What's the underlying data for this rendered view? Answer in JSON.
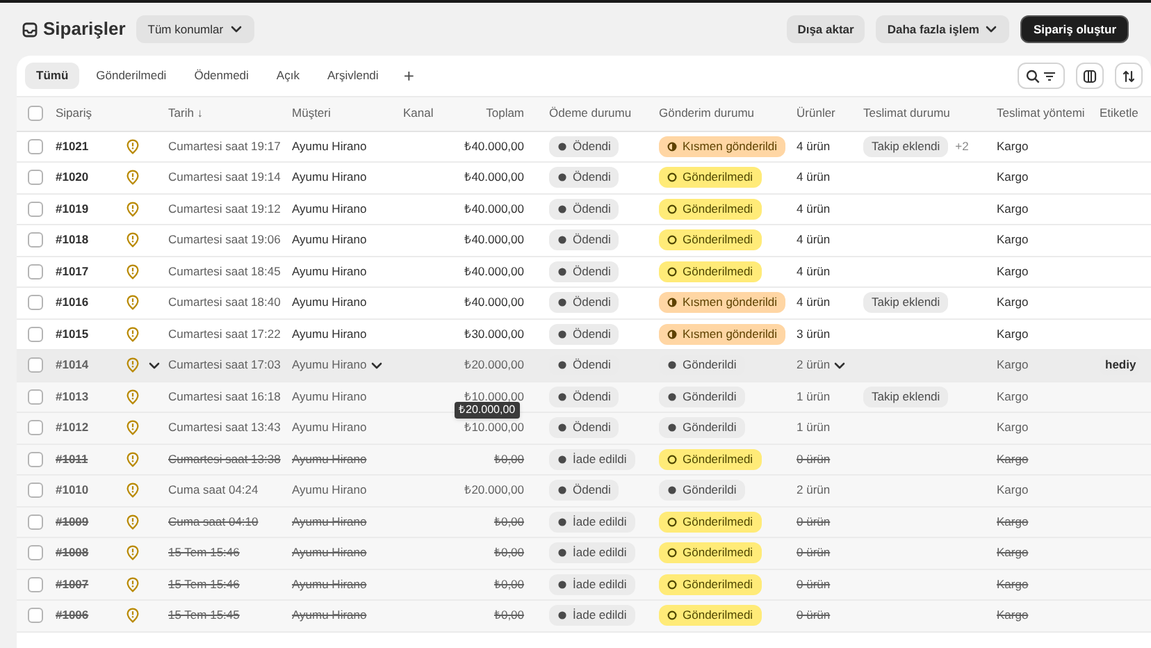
{
  "header": {
    "title": "Siparişler",
    "location_filter": "Tüm konumlar",
    "actions": [
      {
        "label": "Dışa aktar",
        "kind": "plain"
      },
      {
        "label": "Daha fazla işlem",
        "kind": "menu"
      },
      {
        "label": "Sipariş oluştur",
        "kind": "primary"
      }
    ]
  },
  "tabs": [
    {
      "label": "Tümü",
      "selected": true
    },
    {
      "label": "Gönderilmedi",
      "selected": false
    },
    {
      "label": "Ödenmedi",
      "selected": false
    },
    {
      "label": "Açık",
      "selected": false
    },
    {
      "label": "Arşivlendi",
      "selected": false
    }
  ],
  "add_tab": "+",
  "table": {
    "columns": [
      "Sipariş",
      "Tarih ↓",
      "Müşteri",
      "Kanal",
      "Toplam",
      "Ödeme durumu",
      "Gönderim durumu",
      "Ürünler",
      "Teslimat durumu",
      "Teslimat yöntemi",
      "Etiketle"
    ],
    "all_checked": false,
    "rows": [
      {
        "checked": false,
        "order": "#1021",
        "date": "Cumartesi saat 19:17",
        "customer": "Ayumu Hirano",
        "total": "₺40.000,00",
        "payment": "Ödendi",
        "fulfillment": {
          "label": "Kısmen gönderildi",
          "kind": "partial"
        },
        "items": "4 ürün",
        "tracking": "Takip eklendi",
        "tracking_extra": "+2",
        "delivery": "Kargo",
        "archived": false,
        "cancelled": false,
        "hovered": false
      },
      {
        "checked": false,
        "order": "#1020",
        "date": "Cumartesi saat 19:14",
        "customer": "Ayumu Hirano",
        "total": "₺40.000,00",
        "payment": "Ödendi",
        "fulfillment": {
          "label": "Gönderilmedi",
          "kind": "unfulfilled"
        },
        "items": "4 ürün",
        "delivery": "Kargo",
        "archived": false,
        "cancelled": false,
        "hovered": false
      },
      {
        "checked": false,
        "order": "#1019",
        "date": "Cumartesi saat 19:12",
        "customer": "Ayumu Hirano",
        "total": "₺40.000,00",
        "payment": "Ödendi",
        "fulfillment": {
          "label": "Gönderilmedi",
          "kind": "unfulfilled"
        },
        "items": "4 ürün",
        "delivery": "Kargo",
        "archived": false,
        "cancelled": false,
        "hovered": false
      },
      {
        "checked": false,
        "order": "#1018",
        "date": "Cumartesi saat 19:06",
        "customer": "Ayumu Hirano",
        "total": "₺40.000,00",
        "payment": "Ödendi",
        "fulfillment": {
          "label": "Gönderilmedi",
          "kind": "unfulfilled"
        },
        "items": "4 ürün",
        "delivery": "Kargo",
        "archived": false,
        "cancelled": false,
        "hovered": false
      },
      {
        "checked": false,
        "order": "#1017",
        "date": "Cumartesi saat 18:45",
        "customer": "Ayumu Hirano",
        "total": "₺40.000,00",
        "payment": "Ödendi",
        "fulfillment": {
          "label": "Gönderilmedi",
          "kind": "unfulfilled"
        },
        "items": "4 ürün",
        "delivery": "Kargo",
        "archived": false,
        "cancelled": false,
        "hovered": false
      },
      {
        "checked": false,
        "order": "#1016",
        "date": "Cumartesi saat 18:40",
        "customer": "Ayumu Hirano",
        "total": "₺40.000,00",
        "payment": "Ödendi",
        "fulfillment": {
          "label": "Kısmen gönderildi",
          "kind": "partial"
        },
        "items": "4 ürün",
        "tracking": "Takip eklendi",
        "delivery": "Kargo",
        "archived": false,
        "cancelled": false,
        "hovered": false
      },
      {
        "checked": false,
        "order": "#1015",
        "date": "Cumartesi saat 17:22",
        "customer": "Ayumu Hirano",
        "total": "₺30.000,00",
        "payment": "Ödendi",
        "fulfillment": {
          "label": "Kısmen gönderildi",
          "kind": "partial"
        },
        "items": "3 ürün",
        "delivery": "Kargo",
        "archived": false,
        "cancelled": false,
        "hovered": false
      },
      {
        "checked": false,
        "order": "#1014",
        "date": "Cumartesi saat 17:03",
        "customer": "Ayumu Hirano",
        "total": "₺20.000,00",
        "payment": "Ödendi",
        "fulfillment": {
          "label": "Gönderildi",
          "kind": "fulfilled"
        },
        "items": "2 ürün",
        "delivery": "Kargo",
        "tag": "hediy",
        "archived": true,
        "cancelled": false,
        "hovered": true
      },
      {
        "checked": false,
        "order": "#1013",
        "date": "Cumartesi saat 16:18",
        "customer": "Ayumu Hirano",
        "total": "₺10.000,00",
        "payment": "Ödendi",
        "fulfillment": {
          "label": "Gönderildi",
          "kind": "fulfilled"
        },
        "items": "1 ürün",
        "tracking": "Takip eklendi",
        "delivery": "Kargo",
        "archived": true,
        "cancelled": false,
        "hovered": false
      },
      {
        "checked": false,
        "order": "#1012",
        "date": "Cumartesi saat 13:43",
        "customer": "Ayumu Hirano",
        "total": "₺10.000,00",
        "payment": "Ödendi",
        "fulfillment": {
          "label": "Gönderildi",
          "kind": "fulfilled"
        },
        "items": "1 ürün",
        "delivery": "Kargo",
        "archived": true,
        "cancelled": false,
        "hovered": false
      },
      {
        "checked": false,
        "order": "#1011",
        "date": "Cumartesi saat 13:38",
        "customer": "Ayumu Hirano",
        "total": "₺0,00",
        "payment": "İade edildi",
        "fulfillment": {
          "label": "Gönderilmedi",
          "kind": "unfulfilled"
        },
        "items": "0 ürün",
        "delivery": "Kargo",
        "archived": true,
        "cancelled": true,
        "hovered": false
      },
      {
        "checked": false,
        "order": "#1010",
        "date": "Cuma saat 04:24",
        "customer": "Ayumu Hirano",
        "total": "₺20.000,00",
        "payment": "Ödendi",
        "fulfillment": {
          "label": "Gönderildi",
          "kind": "fulfilled"
        },
        "items": "2 ürün",
        "delivery": "Kargo",
        "archived": true,
        "cancelled": false,
        "hovered": false
      },
      {
        "checked": false,
        "order": "#1009",
        "date": "Cuma saat 04:10",
        "customer": "Ayumu Hirano",
        "total": "₺0,00",
        "payment": "İade edildi",
        "fulfillment": {
          "label": "Gönderilmedi",
          "kind": "unfulfilled"
        },
        "items": "0 ürün",
        "delivery": "Kargo",
        "archived": true,
        "cancelled": true,
        "hovered": false
      },
      {
        "checked": false,
        "order": "#1008",
        "date": "15 Tem 15:46",
        "customer": "Ayumu Hirano",
        "total": "₺0,00",
        "payment": "İade edildi",
        "fulfillment": {
          "label": "Gönderilmedi",
          "kind": "unfulfilled"
        },
        "items": "0 ürün",
        "delivery": "Kargo",
        "archived": true,
        "cancelled": true,
        "hovered": false
      },
      {
        "checked": false,
        "order": "#1007",
        "date": "15 Tem 15:46",
        "customer": "Ayumu Hirano",
        "total": "₺0,00",
        "payment": "İade edildi",
        "fulfillment": {
          "label": "Gönderilmedi",
          "kind": "unfulfilled"
        },
        "items": "0 ürün",
        "delivery": "Kargo",
        "archived": true,
        "cancelled": true,
        "hovered": false
      },
      {
        "checked": false,
        "order": "#1006",
        "date": "15 Tem 15:45",
        "customer": "Ayumu Hirano",
        "total": "₺0,00",
        "payment": "İade edildi",
        "fulfillment": {
          "label": "Gönderilmedi",
          "kind": "unfulfilled"
        },
        "items": "0 ürün",
        "delivery": "Kargo",
        "archived": true,
        "cancelled": true,
        "hovered": false
      }
    ]
  },
  "tooltip": "₺20.000,00"
}
